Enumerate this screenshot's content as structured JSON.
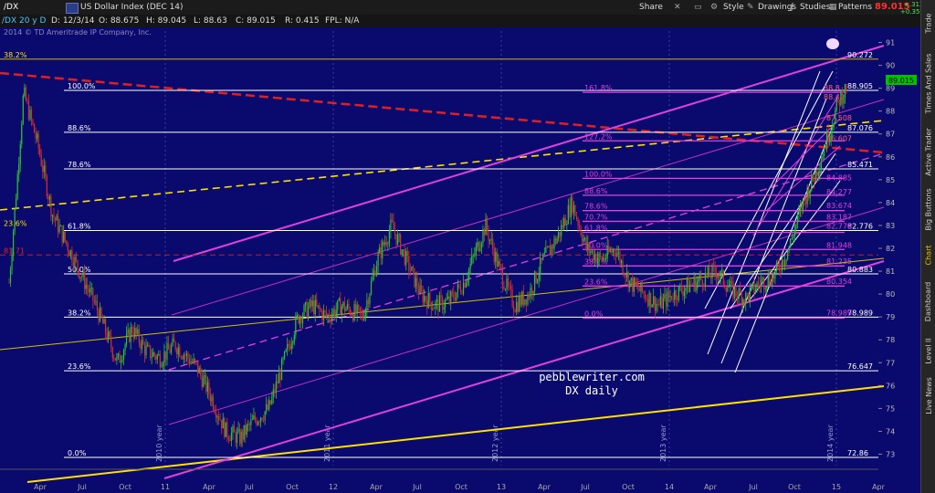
{
  "toolbar": {
    "symbol": "/DX",
    "name": "US Dollar Index (DEC 14)",
    "share": "Share",
    "style": "Style",
    "drawings": "Drawings",
    "studies": "Studies",
    "patterns": "Patterns",
    "last": "89.015",
    "change": "+.312",
    "change_pct": "+0.35%"
  },
  "infobar": {
    "period": "/DX 20 y D",
    "date": "D: 12/3/14",
    "open": "O: 88.675",
    "high": "H: 89.045",
    "low": "L: 88.63",
    "close": "C: 89.015",
    "range": "R: 0.415",
    "fpl": "FPL: N/A",
    "copyright": "2014 © TD Ameritrade IP Company, Inc."
  },
  "watermark": {
    "line1": "pebblewriter.com",
    "line2": "DX daily"
  },
  "side_tabs": [
    "Trade",
    "Times And Sales",
    "Active Trader",
    "Big Buttons",
    "Chart",
    "Dashboard",
    "Level II",
    "Live News"
  ],
  "colors": {
    "background": "#0a0a6e",
    "magenta": "#e040e0",
    "yellow": "#ffe000",
    "red": "#e02020",
    "white": "#ffffff",
    "candle_up": "#30c030",
    "candle_down": "#d03030",
    "last_price": "#00d000"
  },
  "chart_data": {
    "type": "candlestick",
    "title": "US Dollar Index (DEC 14)",
    "ylim": [
      72.5,
      91.5
    ],
    "y_ticks": [
      73,
      74,
      75,
      76,
      77,
      78,
      79,
      80,
      81,
      82,
      83,
      84,
      85,
      86,
      87,
      88,
      89,
      90,
      91
    ],
    "x_ticks": [
      "Apr",
      "Jul",
      "Oct",
      "11",
      "Apr",
      "Jul",
      "Oct",
      "12",
      "Apr",
      "Jul",
      "Oct",
      "13",
      "Apr",
      "Jul",
      "Oct",
      "14",
      "Apr",
      "Jul",
      "Oct",
      "15",
      "Apr"
    ],
    "year_labels": [
      "2010 year",
      "2011 year",
      "2012 year",
      "2013 year",
      "2014 year"
    ],
    "last_price": 89.015,
    "price_path": [
      [
        0,
        80.5
      ],
      [
        0.05,
        84.5
      ],
      [
        0.1,
        88.8
      ],
      [
        0.2,
        86.5
      ],
      [
        0.3,
        83.5
      ],
      [
        0.45,
        81.5
      ],
      [
        0.6,
        79.5
      ],
      [
        0.75,
        77
      ],
      [
        0.85,
        78.5
      ],
      [
        0.95,
        77.5
      ],
      [
        1.05,
        77.2
      ],
      [
        1.15,
        77.8
      ],
      [
        1.3,
        76.8
      ],
      [
        1.4,
        75.5
      ],
      [
        1.5,
        74
      ],
      [
        1.6,
        73.7
      ],
      [
        1.7,
        74.5
      ],
      [
        1.8,
        75
      ],
      [
        1.9,
        77
      ],
      [
        2.0,
        79
      ],
      [
        2.1,
        79.5
      ],
      [
        2.2,
        79
      ],
      [
        2.3,
        79.5
      ],
      [
        2.45,
        79
      ],
      [
        2.55,
        81.5
      ],
      [
        2.65,
        83
      ],
      [
        2.75,
        81.5
      ],
      [
        2.85,
        80
      ],
      [
        2.95,
        79.5
      ],
      [
        3.05,
        79.7
      ],
      [
        3.15,
        80.5
      ],
      [
        3.3,
        83
      ],
      [
        3.4,
        81
      ],
      [
        3.5,
        79.5
      ],
      [
        3.6,
        80
      ],
      [
        3.7,
        81.5
      ],
      [
        3.8,
        82.5
      ],
      [
        3.9,
        84
      ],
      [
        4.0,
        82
      ],
      [
        4.1,
        81.5
      ],
      [
        4.2,
        82
      ],
      [
        4.3,
        80.5
      ],
      [
        4.4,
        80
      ],
      [
        4.5,
        79.5
      ],
      [
        4.6,
        80
      ],
      [
        4.75,
        80.5
      ],
      [
        4.9,
        81
      ],
      [
        5.0,
        80.2
      ],
      [
        5.1,
        79.8
      ],
      [
        5.2,
        80.5
      ],
      [
        5.3,
        80.8
      ],
      [
        5.4,
        82
      ],
      [
        5.5,
        84
      ],
      [
        5.6,
        85.5
      ],
      [
        5.65,
        86.5
      ],
      [
        5.7,
        87.5
      ],
      [
        5.75,
        88.5
      ],
      [
        5.8,
        89.015
      ]
    ],
    "fib_levels_left": [
      {
        "label": "100.0%",
        "value": 88.905
      },
      {
        "label": "88.6%",
        "value": 87.076
      },
      {
        "label": "78.6%",
        "value": 85.471
      },
      {
        "label": "61.8%",
        "value": 82.776
      },
      {
        "label": "50.0%",
        "value": 80.883
      },
      {
        "label": "38.2%",
        "value": 78.989
      },
      {
        "label": "23.6%",
        "value": 76.647
      },
      {
        "label": "0.0%",
        "value": 72.86
      }
    ],
    "fib_right_values": [
      "90.272",
      "88.905",
      "87.076",
      "85.471",
      "82.776",
      "80.883",
      "78.989",
      "76.647",
      "72.86"
    ],
    "fib_levels_mid": [
      {
        "label": "161.8%",
        "value": 88.82
      },
      {
        "label": "127.2%",
        "value": 86.7
      },
      {
        "label": "100.0%",
        "value": 85.06
      },
      {
        "label": "88.6%",
        "value": 84.32
      },
      {
        "label": "78.6%",
        "value": 83.65
      },
      {
        "label": "70.7%",
        "value": 83.18
      },
      {
        "label": "61.8%",
        "value": 82.7
      },
      {
        "label": "50.0%",
        "value": 81.95
      },
      {
        "label": "38.2%",
        "value": 81.23
      },
      {
        "label": "23.6%",
        "value": 80.35
      },
      {
        "label": "0.0%",
        "value": 78.95
      }
    ],
    "fib_mid_values": [
      "88.8",
      "88.42",
      "87.508",
      "86.607",
      "84.885",
      "84.277",
      "83.674",
      "83.187",
      "82.776",
      "81.948",
      "81.235",
      "80.354",
      "78.989"
    ],
    "other_labels": [
      {
        "label": "38.2%",
        "value": 90.272
      },
      {
        "label": "23.6%",
        "value": 82.9
      },
      {
        "label": "81.71",
        "value": 81.71
      }
    ]
  }
}
